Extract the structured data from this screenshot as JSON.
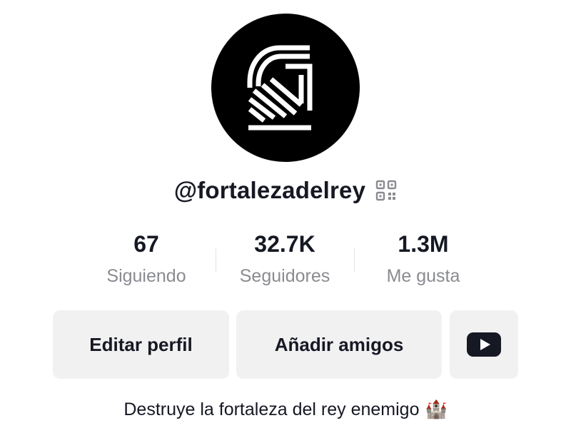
{
  "profile": {
    "handle": "@fortalezadelrey",
    "bio": "Destruye la fortaleza del rey enemigo",
    "bio_emoji": "🏰"
  },
  "stats": [
    {
      "value": "67",
      "label": "Siguiendo"
    },
    {
      "value": "32.7K",
      "label": "Seguidores"
    },
    {
      "value": "1.3M",
      "label": "Me gusta"
    }
  ],
  "buttons": {
    "edit_profile": "Editar perfil",
    "add_friends": "Añadir amigos"
  },
  "icons": {
    "avatar": "knight-logo-icon",
    "qr": "qr-code-icon",
    "youtube": "youtube-icon",
    "castle": "castle-emoji"
  }
}
